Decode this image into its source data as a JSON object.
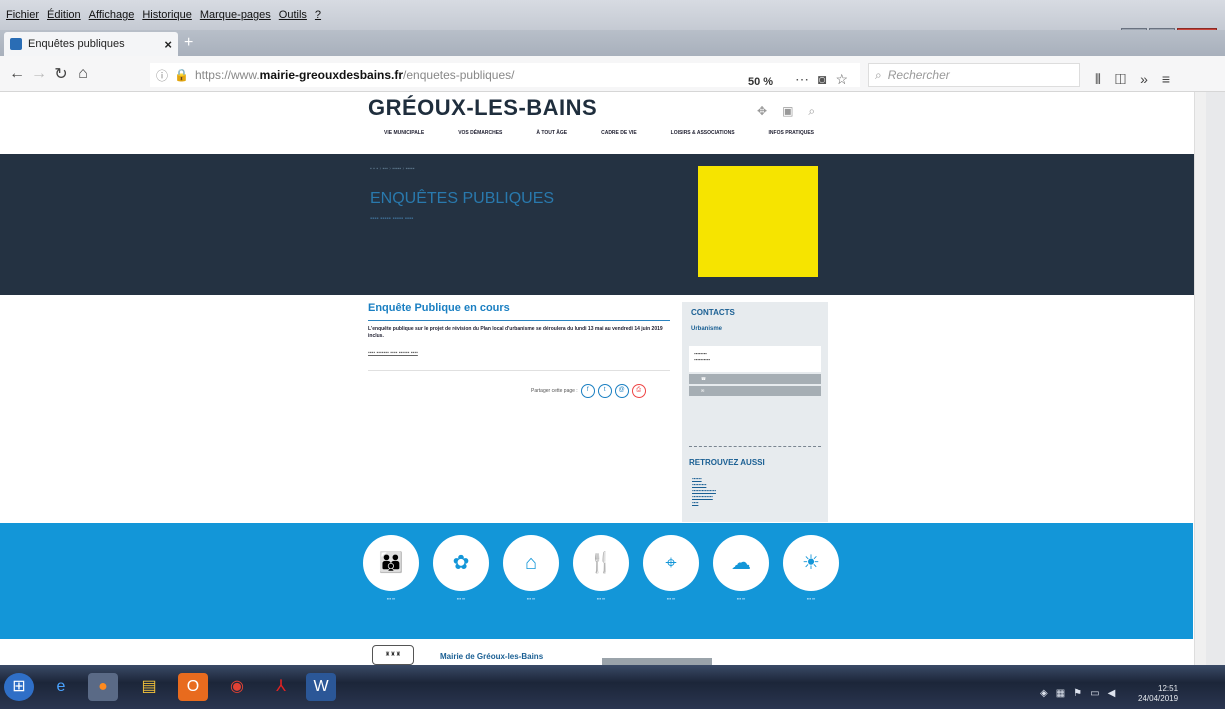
{
  "menu": {
    "items": [
      "Fichier",
      "Édition",
      "Affichage",
      "Historique",
      "Marque-pages",
      "Outils",
      "?"
    ]
  },
  "tab": {
    "title": "Enquêtes publiques"
  },
  "url": {
    "prefix": "https://www.",
    "host": "mairie-greouxdesbains.fr",
    "path": "/enquetes-publiques/"
  },
  "toolbar": {
    "zoom": "50 %",
    "search_placeholder": "Rechercher"
  },
  "site": {
    "title": "GRÉOUX-LES-BAINS",
    "nav": [
      "VIE MUNICIPALE",
      "VOS DÉMARCHES",
      "À TOUT ÂGE",
      "CADRE DE VIE",
      "LOISIRS & ASSOCIATIONS",
      "INFOS PRATIQUES"
    ],
    "hero_title": "ENQUÊTES PUBLIQUES",
    "content_title": "Enquête Publique en cours",
    "content_text": "L'enquête publique sur le projet de révision du Plan local d'urbanisme se déroulera du lundi 13 mai au vendredi 14 juin 2019 inclus.",
    "share_label": "Partager cette page :",
    "sidebar_title": "CONTACTS",
    "sidebar_sub": "Urbanisme",
    "sidebar_title2": "RETROUVEZ AUSSI",
    "footer_name": "Mairie de Gréoux-les-Bains"
  },
  "clock": {
    "time": "12:51",
    "date": "24/04/2019"
  }
}
